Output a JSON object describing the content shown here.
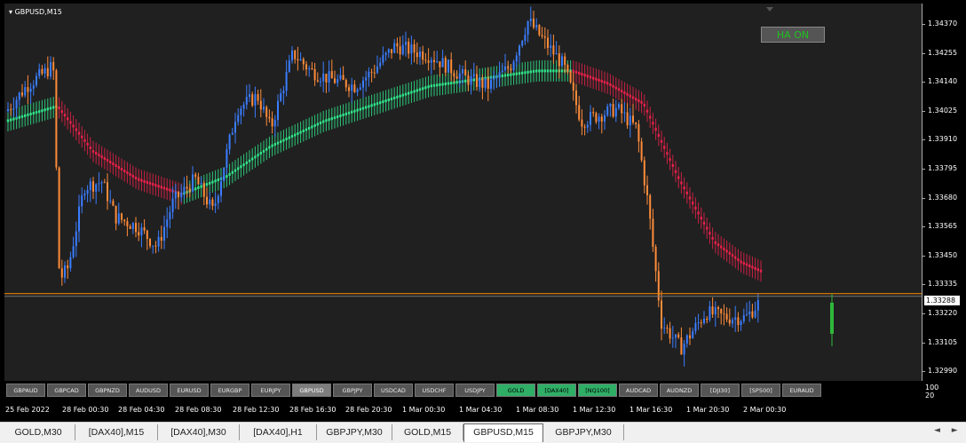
{
  "chart": {
    "title": "GBPUSD,M15",
    "ha_button": "HA ON",
    "current_price": "1.33288",
    "price_ticks": [
      "1.34370",
      "1.34255",
      "1.34140",
      "1.34025",
      "1.33910",
      "1.33795",
      "1.33680",
      "1.33565",
      "1.33450",
      "1.33335",
      "1.33220",
      "1.33105",
      "1.32990"
    ],
    "price_range": [
      1.3297,
      1.34435
    ],
    "time_ticks": [
      "25 Feb 2022",
      "28 Feb 00:30",
      "28 Feb 04:30",
      "28 Feb 08:30",
      "28 Feb 12:30",
      "28 Feb 16:30",
      "28 Feb 20:30",
      "1 Mar 00:30",
      "1 Mar 04:30",
      "1 Mar 08:30",
      "1 Mar 12:30",
      "1 Mar 16:30",
      "1 Mar 20:30",
      "2 Mar 00:30"
    ],
    "sub_scale": [
      "100",
      "20"
    ],
    "colors": {
      "bull_candle": "#3a7dff",
      "bear_candle": "#ff8c3a",
      "ma_up": "#2fe58a",
      "ma_down": "#e8204a",
      "price_line": "#ff8c00"
    }
  },
  "symbols": [
    {
      "label": "GBPAUD",
      "state": "normal"
    },
    {
      "label": "GBPCAD",
      "state": "normal"
    },
    {
      "label": "GBPNZD",
      "state": "normal"
    },
    {
      "label": "AUDUSD",
      "state": "normal"
    },
    {
      "label": "EURUSD",
      "state": "normal"
    },
    {
      "label": "EURGBP",
      "state": "normal"
    },
    {
      "label": "EURJPY",
      "state": "normal"
    },
    {
      "label": "GBPUSD",
      "state": "active"
    },
    {
      "label": "GBPJPY",
      "state": "normal"
    },
    {
      "label": "USDCAD",
      "state": "normal"
    },
    {
      "label": "USDCHF",
      "state": "normal"
    },
    {
      "label": "USDJPY",
      "state": "normal"
    },
    {
      "label": "GOLD",
      "state": "green"
    },
    {
      "label": "[DAX40]",
      "state": "green"
    },
    {
      "label": "[NQ100]",
      "state": "green"
    },
    {
      "label": "AUDCAD",
      "state": "normal"
    },
    {
      "label": "AUDNZD",
      "state": "normal"
    },
    {
      "label": "[DJI30]",
      "state": "normal"
    },
    {
      "label": "[SP500]",
      "state": "normal"
    },
    {
      "label": "EURAUD",
      "state": "normal"
    }
  ],
  "tabs": [
    {
      "label": "GOLD,M30",
      "active": false
    },
    {
      "label": "[DAX40],M15",
      "active": false
    },
    {
      "label": "[DAX40],M30",
      "active": false
    },
    {
      "label": "[DAX40],H1",
      "active": false
    },
    {
      "label": "GBPJPY,M30",
      "active": false
    },
    {
      "label": "GOLD,M15",
      "active": false
    },
    {
      "label": "GBPUSD,M15",
      "active": true
    },
    {
      "label": "GBPJPY,M30",
      "active": false
    }
  ],
  "tab_scroll": {
    "left": "◄",
    "right": "►"
  }
}
